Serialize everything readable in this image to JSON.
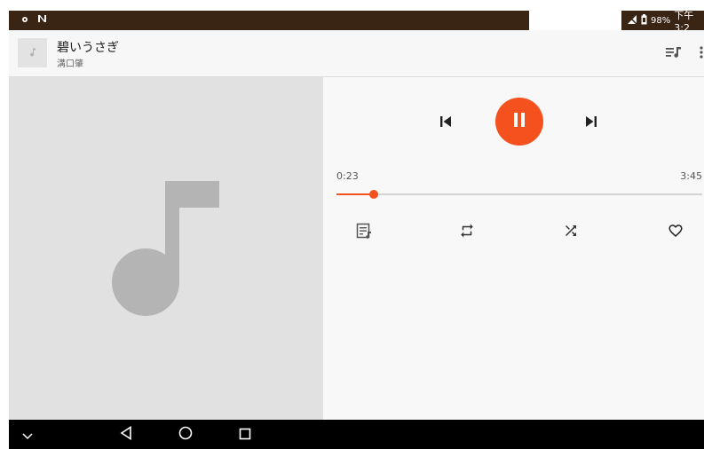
{
  "status_bar": {
    "battery": "98%",
    "time": "下午3:2",
    "left_icons": [
      "settings-dot-icon",
      "n-icon"
    ],
    "colors": {
      "bar": "#3a2414"
    }
  },
  "header": {
    "title": "碧いうさぎ",
    "artist": "溝口肇",
    "actions": [
      "queue-music-icon",
      "more-vert-icon"
    ]
  },
  "player": {
    "accent": "#f4511e",
    "current_time": "0:23",
    "total_time": "3:45",
    "progress": 0.102,
    "state": "playing",
    "controls": [
      "skip-previous-icon",
      "pause-icon",
      "skip-next-icon"
    ],
    "actions": [
      "lyrics-icon",
      "repeat-icon",
      "shuffle-icon",
      "favorite-icon"
    ]
  },
  "nav_bar": {
    "buttons": [
      "chevron-down-icon",
      "back-icon",
      "home-icon",
      "recents-icon"
    ]
  }
}
